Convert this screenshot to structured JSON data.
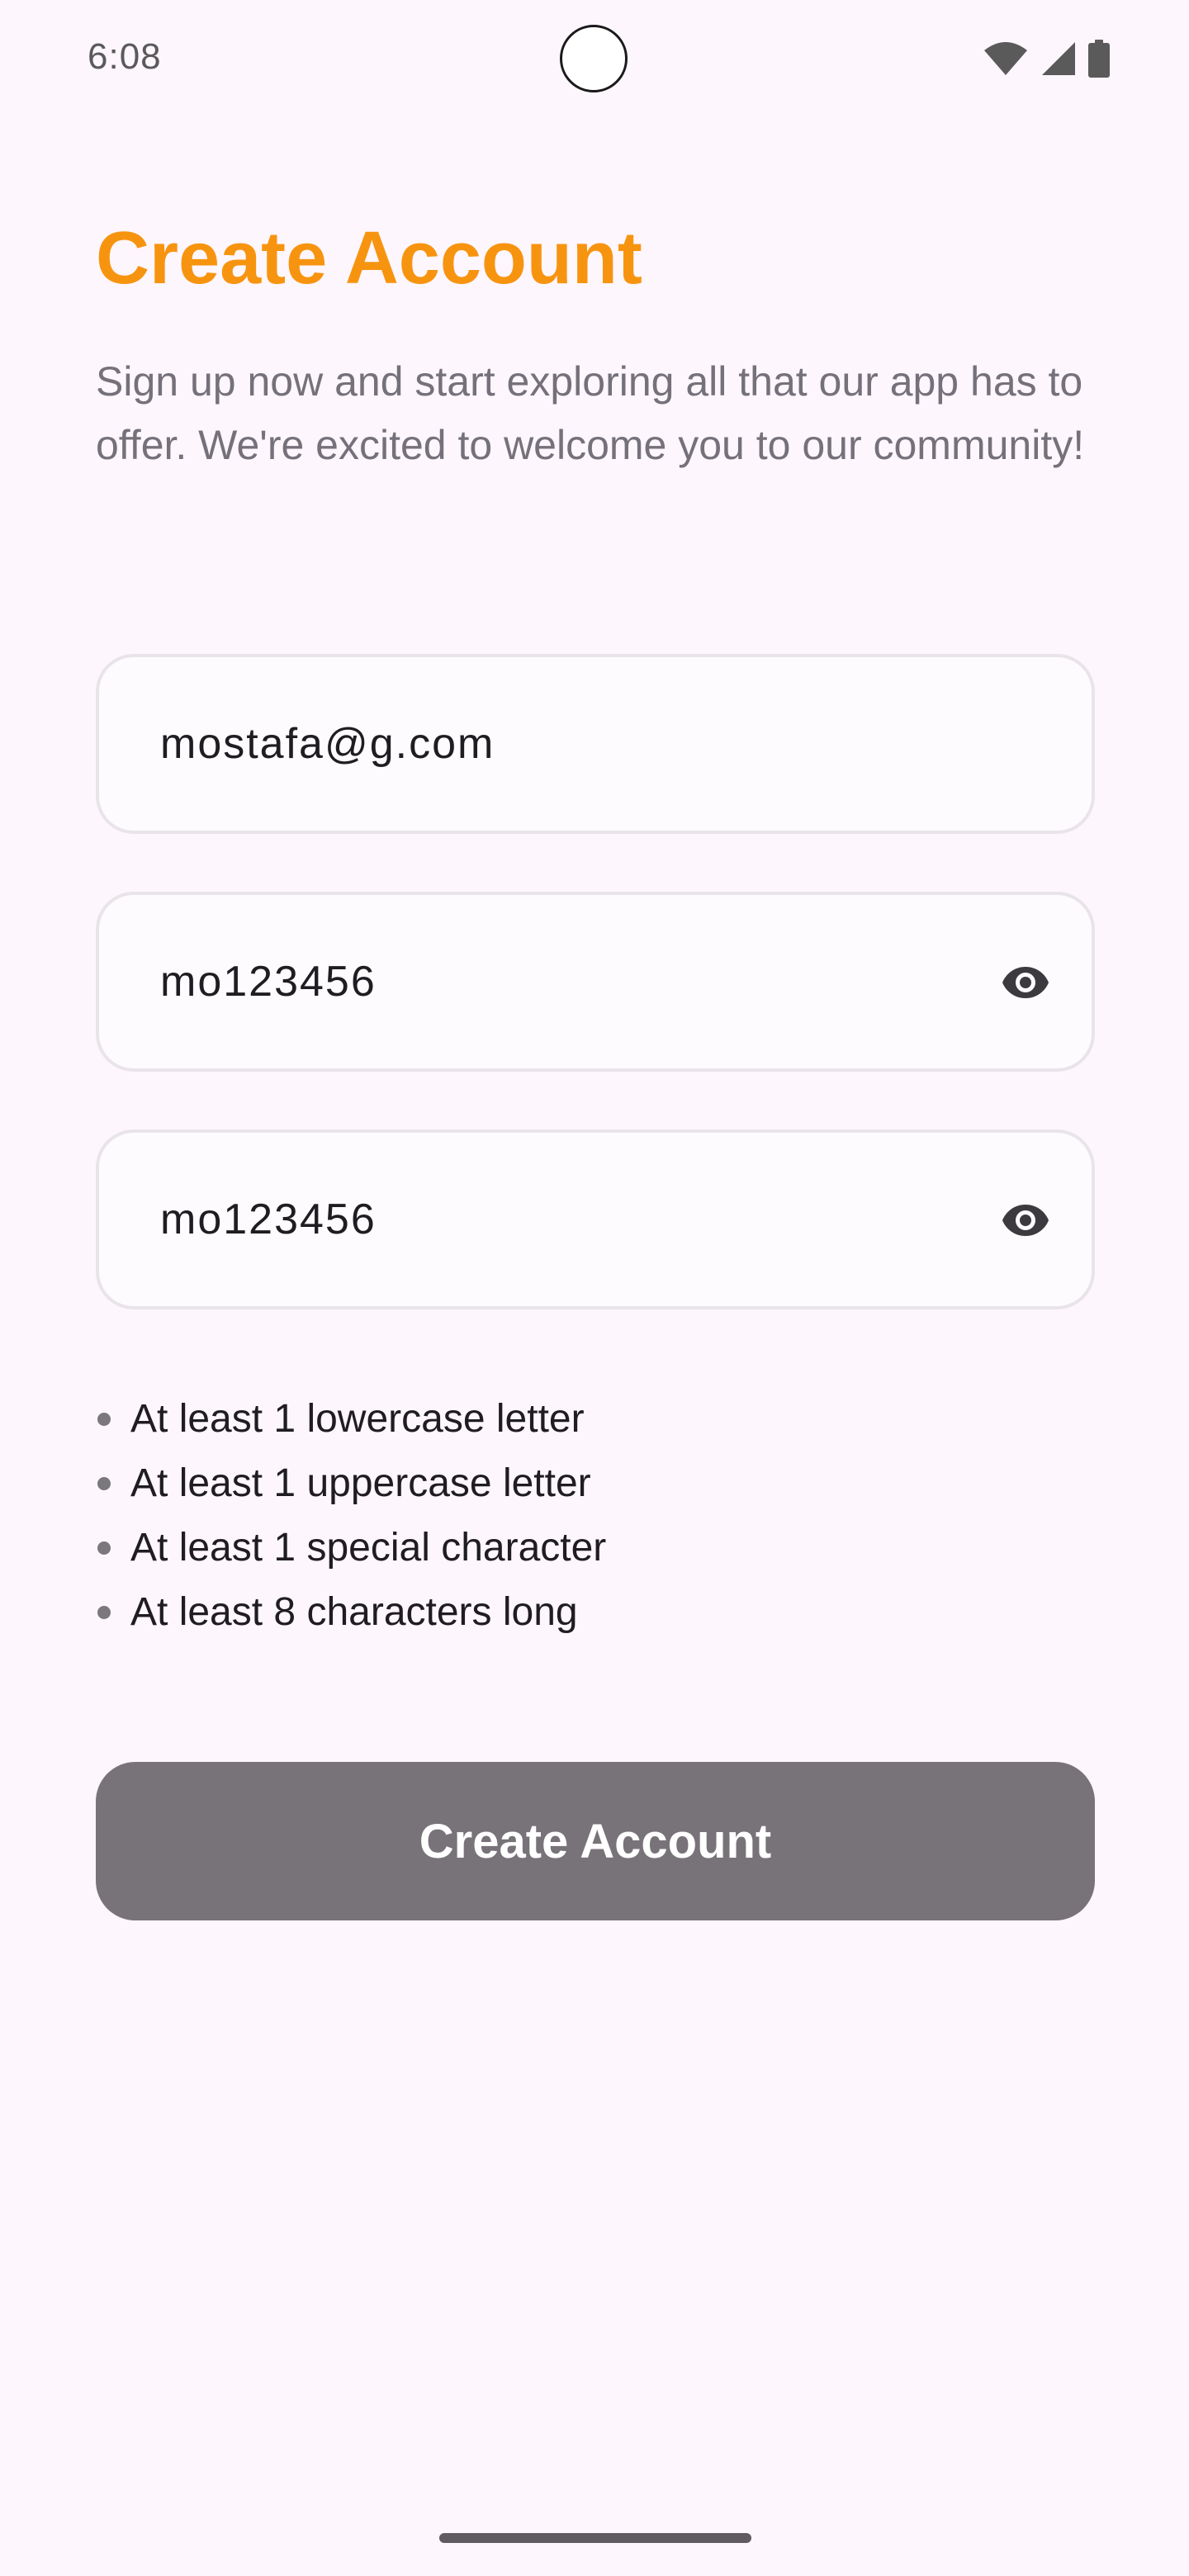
{
  "status_bar": {
    "time": "6:08",
    "icons": [
      "wifi-icon",
      "cellular-signal-icon",
      "battery-icon"
    ]
  },
  "header": {
    "title": "Create Account",
    "subtitle": "Sign up now and start exploring all that our app has to offer. We're excited to welcome you to our community!"
  },
  "form": {
    "email": {
      "value": "mostafa@g.com"
    },
    "password": {
      "value": "mo123456",
      "toggle_icon": "eye-icon"
    },
    "confirm_password": {
      "value": "mo123456",
      "toggle_icon": "eye-icon"
    },
    "requirements": [
      "At least 1 lowercase letter",
      "At least 1 uppercase letter",
      "At least 1 special character",
      "At least 8 characters long"
    ],
    "submit_label": "Create Account"
  },
  "colors": {
    "background": "#fdf6fd",
    "title_accent": "#f7940f",
    "button_disabled": "#787378"
  }
}
